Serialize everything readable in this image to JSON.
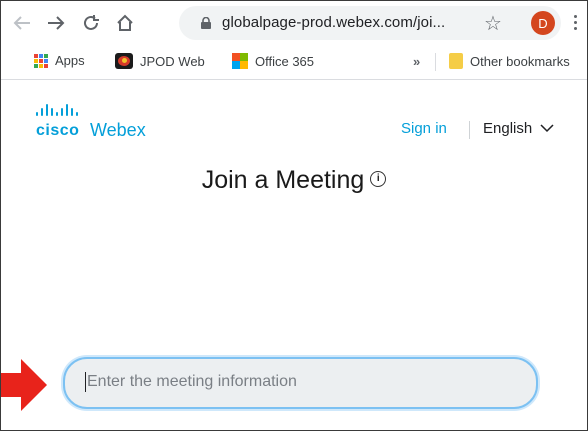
{
  "browser": {
    "url": "globalpage-prod.webex.com/joi...",
    "profile_initial": "D",
    "bookmarks": [
      {
        "label": "Apps",
        "icon": "apps-grid-icon"
      },
      {
        "label": "JPOD Web",
        "icon": "jpod-site-icon"
      },
      {
        "label": "Office 365",
        "icon": "office365-icon"
      }
    ],
    "overflow_label": "»",
    "other_bookmarks": "Other bookmarks"
  },
  "webex": {
    "logo_cisco": "cisco",
    "logo_webex": "Webex",
    "sign_in": "Sign in",
    "language": "English",
    "title": "Join a Meeting",
    "info_glyph": "i",
    "input_placeholder": "Enter the meeting information"
  },
  "colors": {
    "webex_blue": "#049fd9",
    "profile_orange": "#d4461e",
    "annotation_red": "#e8231b"
  }
}
